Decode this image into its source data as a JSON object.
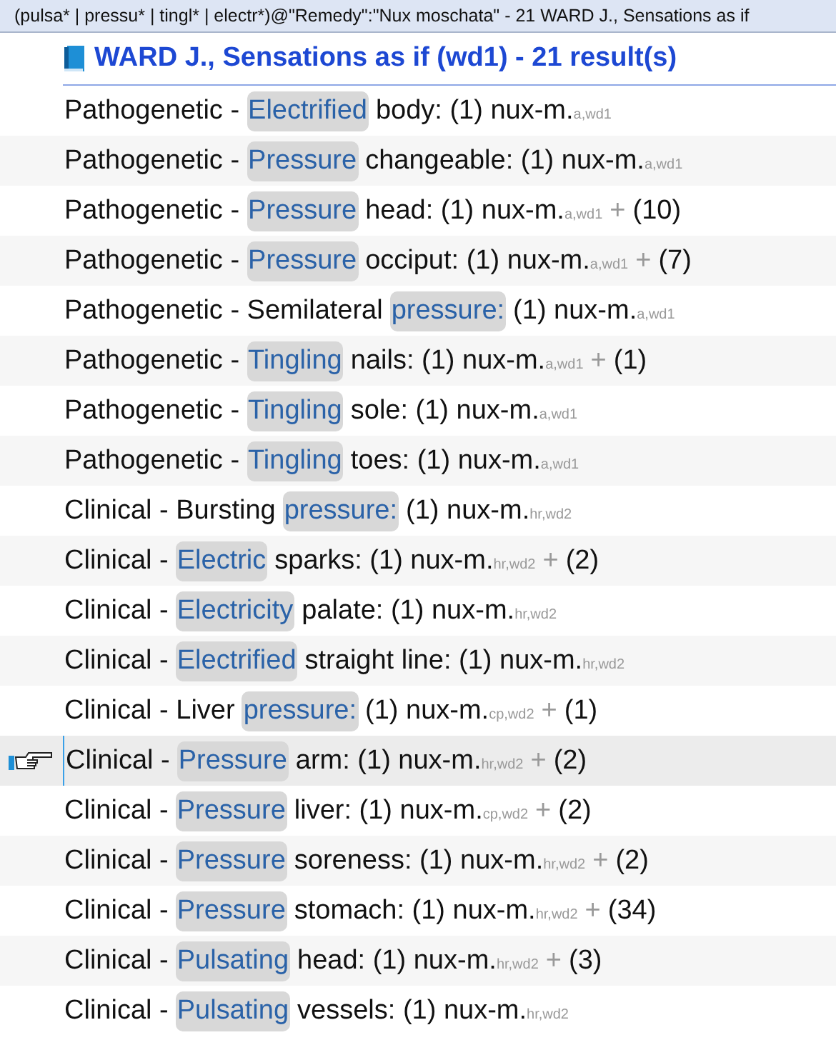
{
  "window": {
    "title": "(pulsa* | pressu* | tingl* | electr*)@\"Remedy\":\"Nux moschata\" - 21 WARD J., Sensations as if"
  },
  "heading": "WARD J., Sensations as if (wd1) - 21 result(s)",
  "rows": [
    {
      "prefix": "Pathogenetic -",
      "highlight": "Electrified",
      "rest": "body: (1) nux-m.",
      "sub": "a,wd1",
      "selected": false
    },
    {
      "prefix": "Pathogenetic -",
      "highlight": "Pressure",
      "rest": "changeable: (1) nux-m.",
      "sub": "a,wd1",
      "selected": false
    },
    {
      "prefix": "Pathogenetic -",
      "highlight": "Pressure",
      "rest": "head: (1) nux-m.",
      "sub": "a,wd1",
      "plus": "+",
      "more": "(10)",
      "selected": false
    },
    {
      "prefix": "Pathogenetic -",
      "highlight": "Pressure",
      "rest": "occiput: (1) nux-m.",
      "sub": "a,wd1",
      "plus": "+",
      "more": "(7)",
      "selected": false
    },
    {
      "prefix": "Pathogenetic - Semilateral",
      "highlight": "pressure:",
      "rest": "(1) nux-m.",
      "sub": "a,wd1",
      "selected": false
    },
    {
      "prefix": "Pathogenetic -",
      "highlight": "Tingling",
      "rest": "nails: (1) nux-m.",
      "sub": "a,wd1",
      "plus": "+",
      "more": "(1)",
      "selected": false
    },
    {
      "prefix": "Pathogenetic -",
      "highlight": "Tingling",
      "rest": "sole: (1) nux-m.",
      "sub": "a,wd1",
      "selected": false
    },
    {
      "prefix": "Pathogenetic -",
      "highlight": "Tingling",
      "rest": "toes: (1) nux-m.",
      "sub": "a,wd1",
      "selected": false
    },
    {
      "prefix": "Clinical - Bursting",
      "highlight": "pressure:",
      "rest": "(1) nux-m.",
      "sub": "hr,wd2",
      "selected": false
    },
    {
      "prefix": "Clinical -",
      "highlight": "Electric",
      "rest": "sparks: (1) nux-m.",
      "sub": "hr,wd2",
      "plus": "+",
      "more": "(2)",
      "selected": false
    },
    {
      "prefix": "Clinical -",
      "highlight": "Electricity",
      "rest": "palate: (1) nux-m.",
      "sub": "hr,wd2",
      "selected": false
    },
    {
      "prefix": "Clinical -",
      "highlight": "Electrified",
      "rest": "straight line: (1) nux-m.",
      "sub": "hr,wd2",
      "selected": false
    },
    {
      "prefix": "Clinical - Liver",
      "highlight": "pressure:",
      "rest": "(1) nux-m.",
      "sub": "cp,wd2",
      "plus": "+",
      "more": "(1)",
      "selected": false
    },
    {
      "prefix": "Clinical -",
      "highlight": "Pressure",
      "rest": "arm: (1) nux-m.",
      "sub": "hr,wd2",
      "plus": "+",
      "more": "(2)",
      "selected": true
    },
    {
      "prefix": "Clinical -",
      "highlight": "Pressure",
      "rest": "liver: (1) nux-m.",
      "sub": "cp,wd2",
      "plus": "+",
      "more": "(2)",
      "selected": false
    },
    {
      "prefix": "Clinical -",
      "highlight": "Pressure",
      "rest": "soreness: (1) nux-m.",
      "sub": "hr,wd2",
      "plus": "+",
      "more": "(2)",
      "selected": false
    },
    {
      "prefix": "Clinical -",
      "highlight": "Pressure",
      "rest": "stomach: (1) nux-m.",
      "sub": "hr,wd2",
      "plus": "+",
      "more": "(34)",
      "selected": false
    },
    {
      "prefix": "Clinical -",
      "highlight": "Pulsating",
      "rest": "head: (1) nux-m.",
      "sub": "hr,wd2",
      "plus": "+",
      "more": "(3)",
      "selected": false
    },
    {
      "prefix": "Clinical -",
      "highlight": "Pulsating",
      "rest": "vessels: (1) nux-m.",
      "sub": "hr,wd2",
      "selected": false
    }
  ]
}
